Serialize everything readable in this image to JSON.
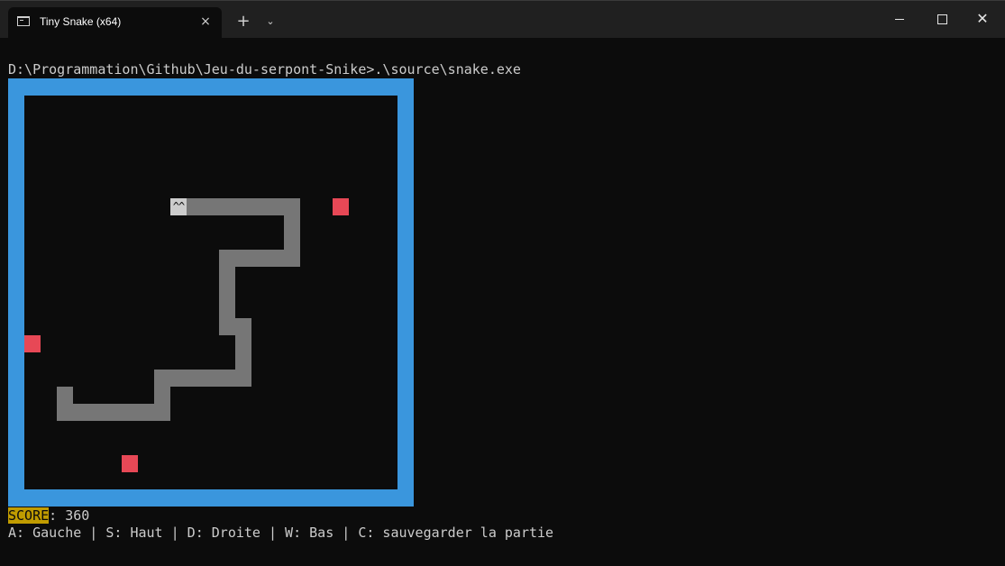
{
  "window": {
    "tab_title": "Tiny Snake (x64)",
    "tab_close_icon": "×",
    "new_tab_icon": "+",
    "dropdown_icon": "⌄",
    "close_icon": "✕"
  },
  "terminal": {
    "prompt": "D:\\Programmation\\Github\\Jeu-du-serpont-Snike>.\\source\\snake.exe",
    "score_label": "SCORE",
    "score_separator": ": ",
    "score_value": "360",
    "controls": "A: Gauche | S: Haut | D: Droite | W: Bas | C: sauvegarder la partie"
  },
  "game": {
    "snake_head": "^^",
    "colors": {
      "wall": "#3a96dd",
      "snake": "#767676",
      "head": "#cccccc",
      "food": "#e74856",
      "score_highlight": "#c19c00"
    }
  }
}
